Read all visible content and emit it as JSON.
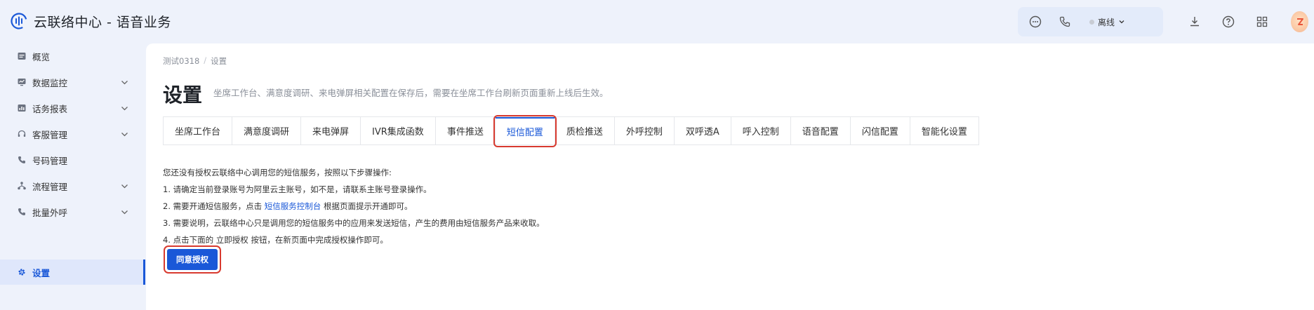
{
  "header": {
    "title": "云联络中心 - 语音业务",
    "status": {
      "label": "离线"
    }
  },
  "sidebar": {
    "items": [
      {
        "label": "概览",
        "icon": "overview-icon",
        "has_children": false
      },
      {
        "label": "数据监控",
        "icon": "monitor-icon",
        "has_children": true
      },
      {
        "label": "话务报表",
        "icon": "report-icon",
        "has_children": true
      },
      {
        "label": "客服管理",
        "icon": "headset-icon",
        "has_children": true
      },
      {
        "label": "号码管理",
        "icon": "phone-icon",
        "has_children": false
      },
      {
        "label": "流程管理",
        "icon": "flow-icon",
        "has_children": true
      },
      {
        "label": "批量外呼",
        "icon": "phone-icon",
        "has_children": true
      },
      {
        "label": "设置",
        "icon": "gear-icon",
        "has_children": false,
        "active": true
      }
    ]
  },
  "breadcrumb": {
    "items": [
      "测试0318",
      "设置"
    ],
    "separator": "/"
  },
  "page": {
    "title": "设置",
    "subtitle": "坐席工作台、满意度调研、来电弹屏相关配置在保存后，需要在坐席工作台刷新页面重新上线后生效。"
  },
  "tabs": [
    {
      "label": "坐席工作台"
    },
    {
      "label": "满意度调研"
    },
    {
      "label": "来电弹屏"
    },
    {
      "label": "IVR集成函数"
    },
    {
      "label": "事件推送"
    },
    {
      "label": "短信配置",
      "active": true
    },
    {
      "label": "质检推送"
    },
    {
      "label": "外呼控制"
    },
    {
      "label": "双呼透A"
    },
    {
      "label": "呼入控制"
    },
    {
      "label": "语音配置"
    },
    {
      "label": "闪信配置"
    },
    {
      "label": "智能化设置"
    }
  ],
  "sms": {
    "intro": "您还没有授权云联络中心调用您的短信服务，按照以下步骤操作:",
    "step1": "1. 请确定当前登录账号为阿里云主账号，如不是，请联系主账号登录操作。",
    "step2_before": "2. 需要开通短信服务，点击 ",
    "step2_link": "短信服务控制台",
    "step2_after": " 根据页面提示开通即可。",
    "step3": "3. 需要说明，云联络中心只是调用您的短信服务中的应用来发送短信，产生的费用由短信服务产品来收取。",
    "step4": "4. 点击下面的 立即授权 按钮，在新页面中完成授权操作即可。",
    "agree_button": "同意授权"
  },
  "colors": {
    "accent": "#1a58d8",
    "highlight": "#d83a2f",
    "background": "#eef2fb"
  }
}
